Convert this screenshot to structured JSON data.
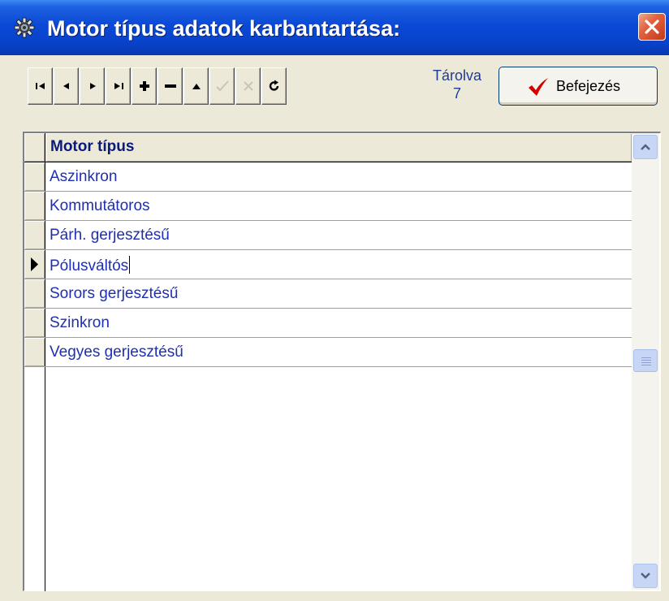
{
  "window": {
    "title": "Motor típus adatok karbantartása:",
    "icon": "gear-icon"
  },
  "toolbar": {
    "buttons": [
      {
        "name": "first-record-button",
        "icon": "first-record-icon",
        "enabled": true
      },
      {
        "name": "previous-record-button",
        "icon": "previous-record-icon",
        "enabled": true
      },
      {
        "name": "next-record-button",
        "icon": "next-record-icon",
        "enabled": true
      },
      {
        "name": "last-record-button",
        "icon": "last-record-icon",
        "enabled": true
      },
      {
        "name": "add-record-button",
        "icon": "plus-icon",
        "enabled": true
      },
      {
        "name": "delete-record-button",
        "icon": "minus-icon",
        "enabled": true
      },
      {
        "name": "edit-record-button",
        "icon": "up-triangle-icon",
        "enabled": true
      },
      {
        "name": "post-edit-button",
        "icon": "check-icon",
        "enabled": false
      },
      {
        "name": "cancel-edit-button",
        "icon": "cancel-icon",
        "enabled": false
      },
      {
        "name": "refresh-button",
        "icon": "refresh-icon",
        "enabled": true
      }
    ],
    "stored_label": "Tárolva",
    "stored_count": "7",
    "finish_label": "Befejezés",
    "finish_icon": "red-checkmark-icon"
  },
  "grid": {
    "column_header": "Motor típus",
    "rows": [
      {
        "value": "Aszinkron"
      },
      {
        "value": "Kommutátoros"
      },
      {
        "value": "Párh. gerjesztésű"
      },
      {
        "value": "Pólusváltós",
        "current": true
      },
      {
        "value": "Sorors gerjesztésű"
      },
      {
        "value": "Szinkron"
      },
      {
        "value": "Vegyes gerjesztésű"
      }
    ]
  },
  "colors": {
    "title_bar": "#0A49D6",
    "cell_text": "#1E2FB4",
    "header_text": "#0A1A7A",
    "close_button": "#E2613F",
    "checkmark": "#D40000"
  }
}
